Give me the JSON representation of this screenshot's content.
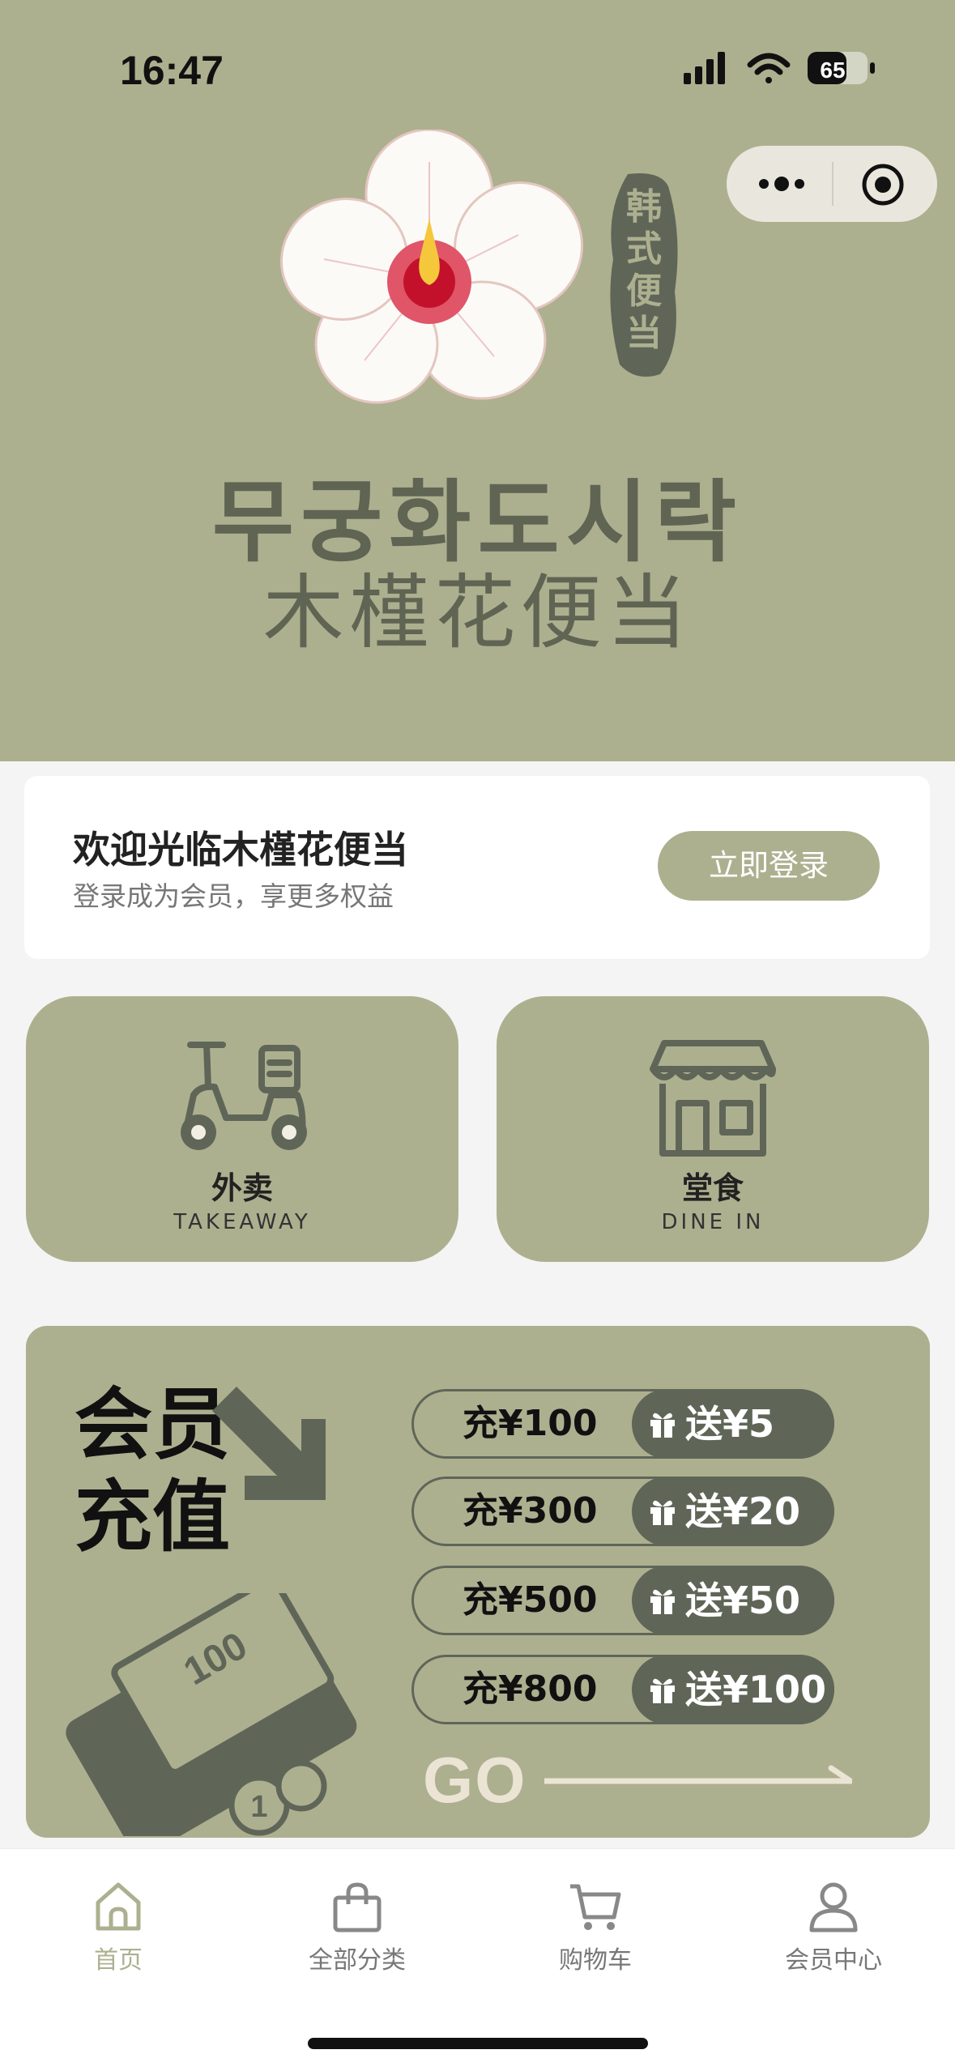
{
  "status_bar": {
    "time": "16:47",
    "battery": "65"
  },
  "brand": {
    "korean_name": "무궁화도시락",
    "chinese_name": "木槿花便当",
    "stamp_text": "韩式便当"
  },
  "welcome": {
    "title": "欢迎光临木槿花便当",
    "subtitle": "登录成为会员，享更多权益",
    "login_label": "立即登录"
  },
  "services": [
    {
      "label": "外卖",
      "sub": "TAKEAWAY",
      "icon": "scooter-icon"
    },
    {
      "label": "堂食",
      "sub": "DINE IN",
      "icon": "store-icon"
    }
  ],
  "recharge": {
    "title_line1": "会员",
    "title_line2": "充值",
    "tiers": [
      {
        "amount": "充¥100",
        "bonus": "送¥5"
      },
      {
        "amount": "充¥300",
        "bonus": "送¥20"
      },
      {
        "amount": "充¥500",
        "bonus": "送¥50"
      },
      {
        "amount": "充¥800",
        "bonus": "送¥100"
      }
    ],
    "go_label": "GO",
    "bill_value": "100",
    "coin_value": "1"
  },
  "tabbar": [
    {
      "label": "首页",
      "icon": "home-icon",
      "active": true
    },
    {
      "label": "全部分类",
      "icon": "bag-icon",
      "active": false
    },
    {
      "label": "购物车",
      "icon": "cart-icon",
      "active": false
    },
    {
      "label": "会员中心",
      "icon": "user-icon",
      "active": false
    }
  ],
  "colors": {
    "brand": "#adb08f",
    "dark": "#5f6658",
    "background": "#f4f4f4"
  }
}
